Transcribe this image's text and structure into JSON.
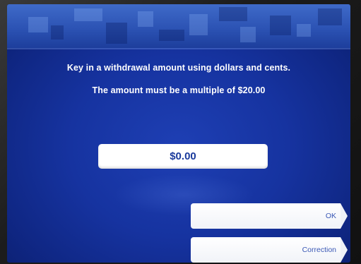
{
  "screen": {
    "instruction_line1": "Key in a withdrawal amount using dollars and cents.",
    "instruction_line2": "The amount must be a multiple of $20.00"
  },
  "amount_field": {
    "value": "$0.00"
  },
  "buttons": {
    "ok_label": "OK",
    "correction_label": "Correction"
  },
  "colors": {
    "screen_blue": "#1633a0",
    "banner_blue": "#2c53b4",
    "button_text": "#3a58b5",
    "amount_text": "#1a3a9c"
  }
}
